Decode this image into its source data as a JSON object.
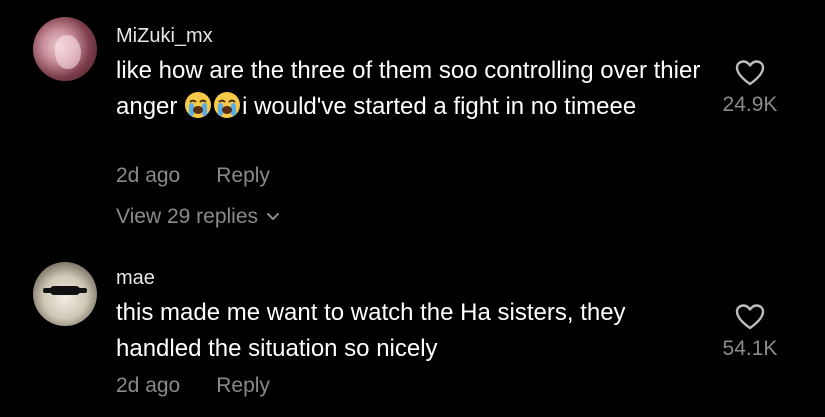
{
  "comments": [
    {
      "username": "MiZuki_mx",
      "text_before": "like how are the three of them soo controlling over thier anger ",
      "text_after": "i would've started a fight in no timeee",
      "emojis": [
        "loudly-crying-face",
        "loudly-crying-face"
      ],
      "time": "2d ago",
      "reply_label": "Reply",
      "view_replies": "View 29 replies",
      "likes": "24.9K"
    },
    {
      "username": "mae",
      "text": "this made me want to watch the Ha sisters, they handled the situation so nicely",
      "time": "2d ago",
      "reply_label": "Reply",
      "likes": "54.1K"
    }
  ],
  "colors": {
    "background": "#000000",
    "text": "#ffffff",
    "muted": "#8a8a8a"
  },
  "icons": {
    "like": "heart-outline-icon",
    "expand": "chevron-down-icon",
    "emoji": "loudly-crying-face-emoji"
  }
}
